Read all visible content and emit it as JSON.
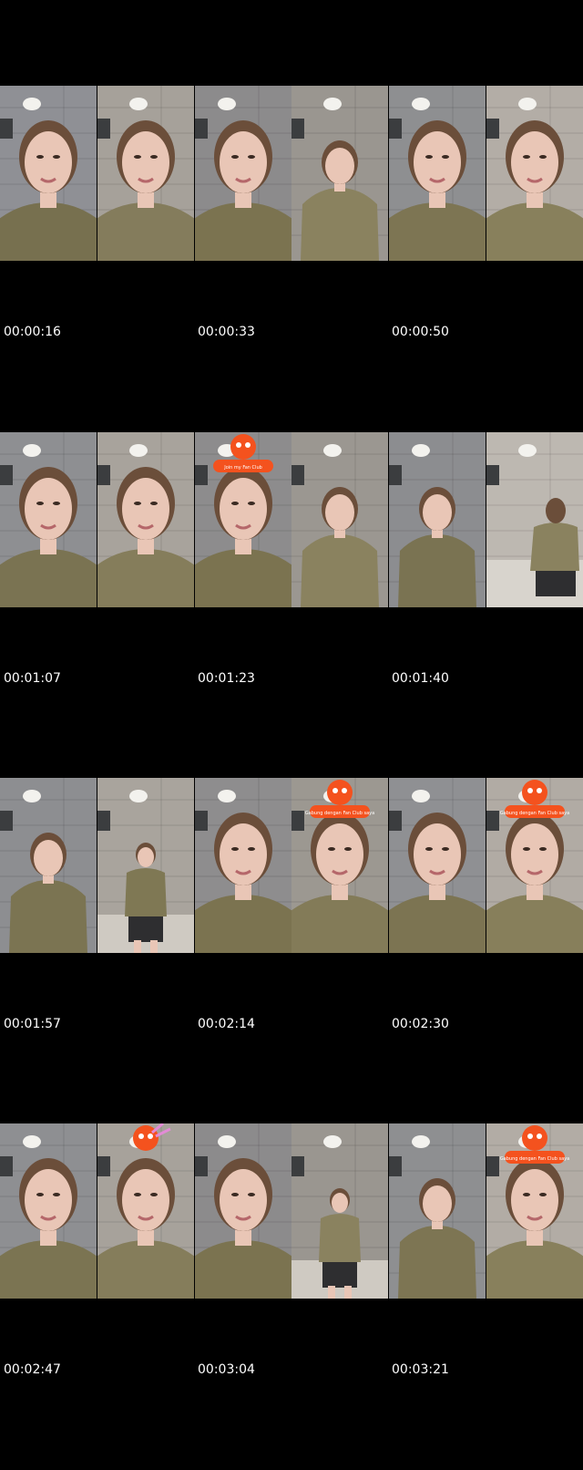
{
  "rows": [
    {
      "timestamps": [
        "00:00:16",
        "00:00:33",
        "00:00:50"
      ],
      "frames": [
        {
          "scene": "close",
          "wall": "#8f9095",
          "shirt": "#77704f",
          "sticker": ""
        },
        {
          "scene": "close",
          "wall": "#a6a19a",
          "shirt": "#847c5c",
          "sticker": ""
        },
        {
          "scene": "close",
          "wall": "#8c8b8c",
          "shirt": "#7b7350",
          "sticker": ""
        },
        {
          "scene": "mid",
          "wall": "#9a9690",
          "shirt": "#8a825f",
          "sticker": ""
        },
        {
          "scene": "close",
          "wall": "#8e8f91",
          "shirt": "#7d7553",
          "sticker": ""
        },
        {
          "scene": "close",
          "wall": "#b3ada6",
          "shirt": "#88805c",
          "sticker": ""
        }
      ]
    },
    {
      "timestamps": [
        "00:01:07",
        "00:01:23",
        "00:01:40"
      ],
      "frames": [
        {
          "scene": "close",
          "wall": "#8e8f92",
          "shirt": "#7a7352",
          "sticker": ""
        },
        {
          "scene": "close",
          "wall": "#a8a39c",
          "shirt": "#857d5b",
          "sticker": ""
        },
        {
          "scene": "close",
          "wall": "#8d8c8d",
          "shirt": "#7b7350",
          "sticker": "Join my Fan Club"
        },
        {
          "scene": "mid",
          "wall": "#9b9791",
          "shirt": "#8a825f",
          "sticker": ""
        },
        {
          "scene": "mid",
          "wall": "#8c8d90",
          "shirt": "#7a7352",
          "sticker": ""
        },
        {
          "scene": "back",
          "wall": "#bdb8b1",
          "shirt": "#8a825f",
          "sticker": ""
        }
      ]
    },
    {
      "timestamps": [
        "00:01:57",
        "00:02:14",
        "00:02:30"
      ],
      "frames": [
        {
          "scene": "mid",
          "wall": "#8d8e91",
          "shirt": "#7b7452",
          "sticker": ""
        },
        {
          "scene": "full",
          "wall": "#a9a49d",
          "shirt": "#7f7854",
          "sticker": ""
        },
        {
          "scene": "close",
          "wall": "#8e8d8e",
          "shirt": "#7b7350",
          "sticker": ""
        },
        {
          "scene": "close",
          "wall": "#9c9891",
          "shirt": "#837b58",
          "sticker": "Gabung dengan Fan Club saya"
        },
        {
          "scene": "close",
          "wall": "#8f9093",
          "shirt": "#7c7452",
          "sticker": ""
        },
        {
          "scene": "close",
          "wall": "#b1aba4",
          "shirt": "#877f5b",
          "sticker": "Gabung dengan Fan Club saya"
        }
      ]
    },
    {
      "timestamps": [
        "00:02:47",
        "00:03:04",
        "00:03:21"
      ],
      "frames": [
        {
          "scene": "close",
          "wall": "#8e8f92",
          "shirt": "#7b7452",
          "sticker": ""
        },
        {
          "scene": "close",
          "wall": "#a7a29b",
          "shirt": "#857d5b",
          "sticker": "bunny"
        },
        {
          "scene": "close",
          "wall": "#8c8b8c",
          "shirt": "#7b7350",
          "sticker": ""
        },
        {
          "scene": "full",
          "wall": "#9a9690",
          "shirt": "#8a825f",
          "sticker": ""
        },
        {
          "scene": "mid",
          "wall": "#8e8f91",
          "shirt": "#7d7553",
          "sticker": ""
        },
        {
          "scene": "close",
          "wall": "#b2aca5",
          "shirt": "#88805c",
          "sticker": "Gabung dengan Fan Club saya"
        }
      ]
    }
  ],
  "colors": {
    "background": "#000000",
    "skin": "#e9c6b6",
    "hair": "#6b4e3a",
    "light": "#f3f2ee",
    "sticker": "#f4521e",
    "timestamp": "#ffffff"
  }
}
